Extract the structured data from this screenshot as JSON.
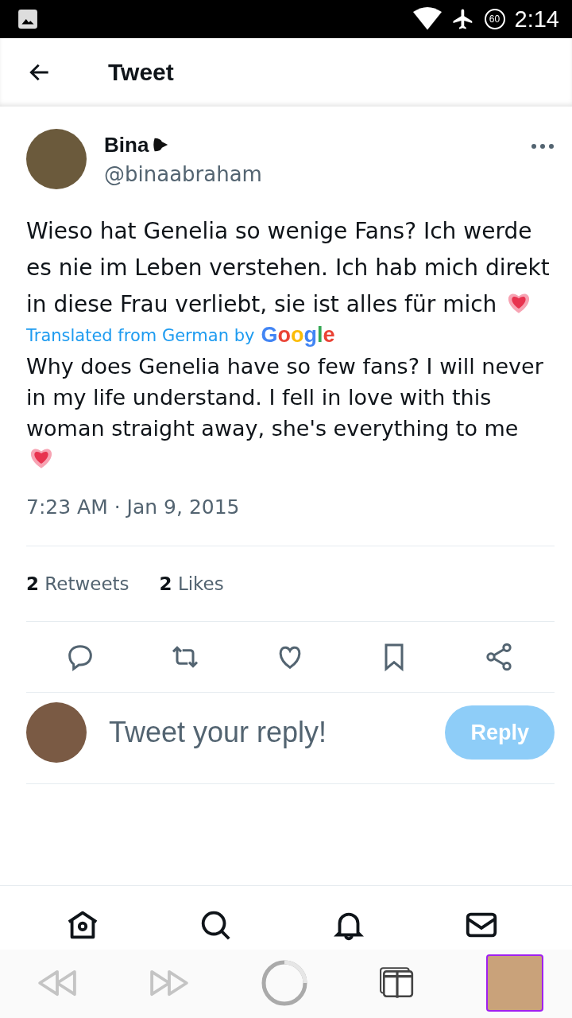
{
  "status_bar": {
    "time": "2:14",
    "battery": "60"
  },
  "header": {
    "title": "Tweet"
  },
  "tweet": {
    "name": "Bina",
    "handle": "@binaabraham",
    "text": "Wieso hat Genelia so wenige Fans? Ich werde es nie im Leben verstehen. Ich hab mich direkt in diese Frau verliebt, sie ist alles für mich",
    "translation_label": "Translated from German by",
    "translation_brand": "Google",
    "translation": "Why does Genelia have so few fans? I will never in my life understand. I fell in love with this woman straight away, she's everything to me",
    "timestamp": "7:23 AM · Jan 9, 2015",
    "stats": [
      "**2** Retweets",
      "**2** Likes"
    ]
  },
  "reply": {
    "placeholder": "Tweet your reply!",
    "button": "Reply",
    "disabled": true
  },
  "nav_tabs": [
    {
      "kind": "home",
      "selected": false
    },
    {
      "kind": "search",
      "selected": false
    },
    {
      "kind": "bell",
      "selected": false
    },
    {
      "kind": "mail",
      "selected": false
    }
  ]
}
